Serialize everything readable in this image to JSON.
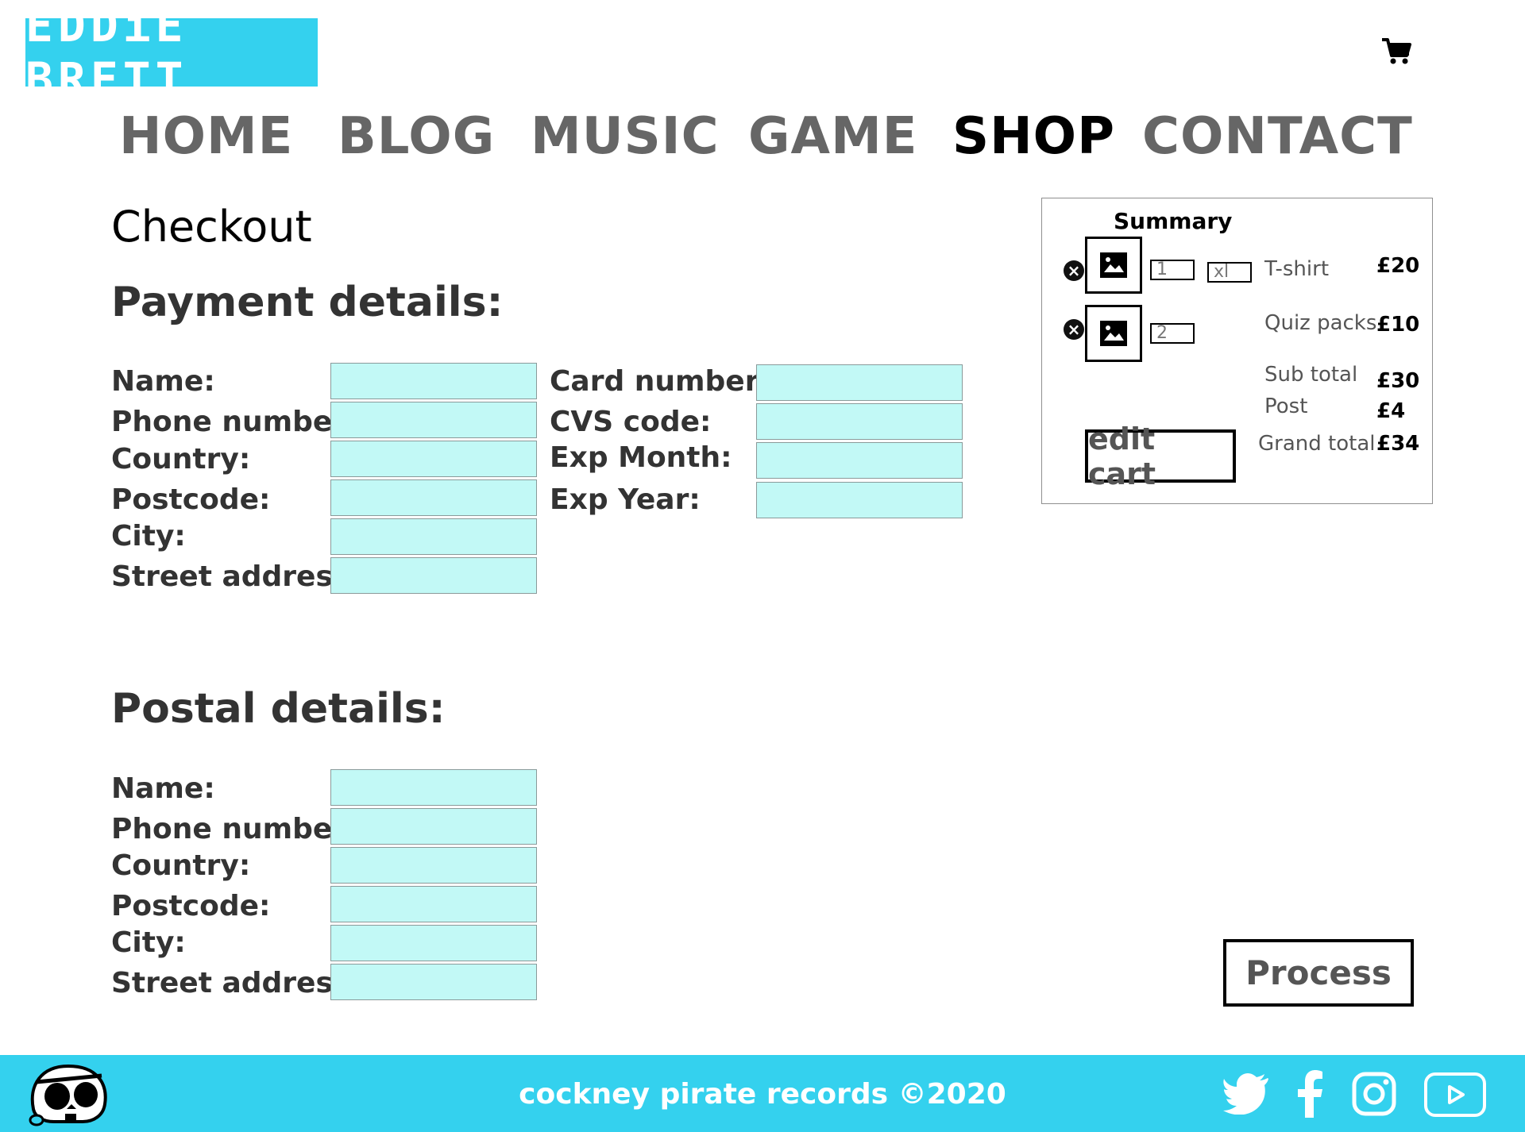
{
  "header": {
    "logo_text": "EDDiE BRETT",
    "cart_icon": "shopping-cart-icon"
  },
  "nav": {
    "items": [
      "HOME",
      "BLOG",
      "MUSIC",
      "GAME",
      "SHOP",
      "CONTACT"
    ],
    "active": "SHOP"
  },
  "checkout": {
    "title": "Checkout",
    "payment": {
      "heading": "Payment details:",
      "left_labels": [
        "Name:",
        "Phone number:",
        "Country:",
        "Postcode:",
        "City:",
        "Street address:"
      ],
      "right_labels": [
        "Card number:",
        "CVS code:",
        "Exp Month:",
        "Exp Year:"
      ]
    },
    "postal": {
      "heading": "Postal details:",
      "labels": [
        "Name:",
        "Phone number:",
        "Country:",
        "Postcode:",
        "City:",
        "Street address:"
      ]
    },
    "process_label": "Process"
  },
  "summary": {
    "title": "Summary",
    "items": [
      {
        "qty": "1",
        "size": "xl",
        "name": "T-shirt",
        "price": "£20"
      },
      {
        "qty": "2",
        "name": "Quiz packs",
        "price": "£10"
      }
    ],
    "sub_total_label": "Sub total",
    "sub_total": "£30",
    "post_label": "Post",
    "post": "£4",
    "grand_total_label": "Grand total",
    "grand_total": "£34",
    "edit_cart_label": "edit cart"
  },
  "footer": {
    "text": "cockney pirate records ©2020",
    "social_icons": [
      "twitter-icon",
      "facebook-icon",
      "instagram-icon",
      "youtube-icon"
    ]
  },
  "colors": {
    "brand_cyan": "#34d1ee",
    "field_fill": "#c2f9f6"
  }
}
